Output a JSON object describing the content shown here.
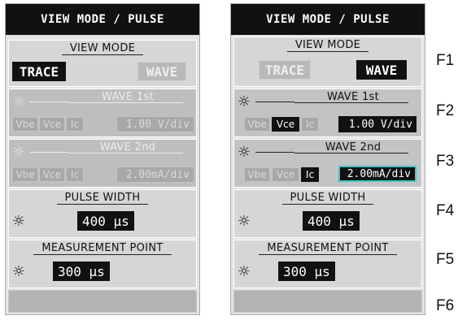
{
  "left": {
    "header": "VIEW MODE / PULSE",
    "view_mode": {
      "title": "VIEW MODE",
      "trace": "TRACE",
      "wave": "WAVE",
      "selected": "TRACE"
    },
    "wave1": {
      "title": "WAVE 1st",
      "chips": [
        "Vbe",
        "Vce",
        "Ic"
      ],
      "value": "1.00 V/div",
      "enabled": false
    },
    "wave2": {
      "title": "WAVE 2nd",
      "chips": [
        "Vbe",
        "Vce",
        "Ic"
      ],
      "value": "2.00mA/div",
      "enabled": false
    },
    "pulse_width": {
      "title": "PULSE WIDTH",
      "value": "400 µs"
    },
    "measurement_point": {
      "title": "MEASUREMENT POINT",
      "value": "300 µs"
    }
  },
  "right": {
    "header": "VIEW MODE / PULSE",
    "view_mode": {
      "title": "VIEW MODE",
      "trace": "TRACE",
      "wave": "WAVE",
      "selected": "WAVE"
    },
    "wave1": {
      "title": "WAVE 1st",
      "chips": [
        "Vbe",
        "Vce",
        "Ic"
      ],
      "selected_chip": "Vce",
      "value": "1.00 V/div",
      "enabled": true
    },
    "wave2": {
      "title": "WAVE 2nd",
      "chips": [
        "Vbe",
        "Vce",
        "Ic"
      ],
      "selected_chip": "Ic",
      "value": "2.00mA/div",
      "value_highlight": "#37c8d0",
      "enabled": true
    },
    "pulse_width": {
      "title": "PULSE WIDTH",
      "value": "400 µs"
    },
    "measurement_point": {
      "title": "MEASUREMENT POINT",
      "value": "300 µs"
    }
  },
  "function_keys": [
    "F1",
    "F2",
    "F3",
    "F4",
    "F5",
    "F6"
  ],
  "icons": {
    "adjust": "gear-icon"
  }
}
